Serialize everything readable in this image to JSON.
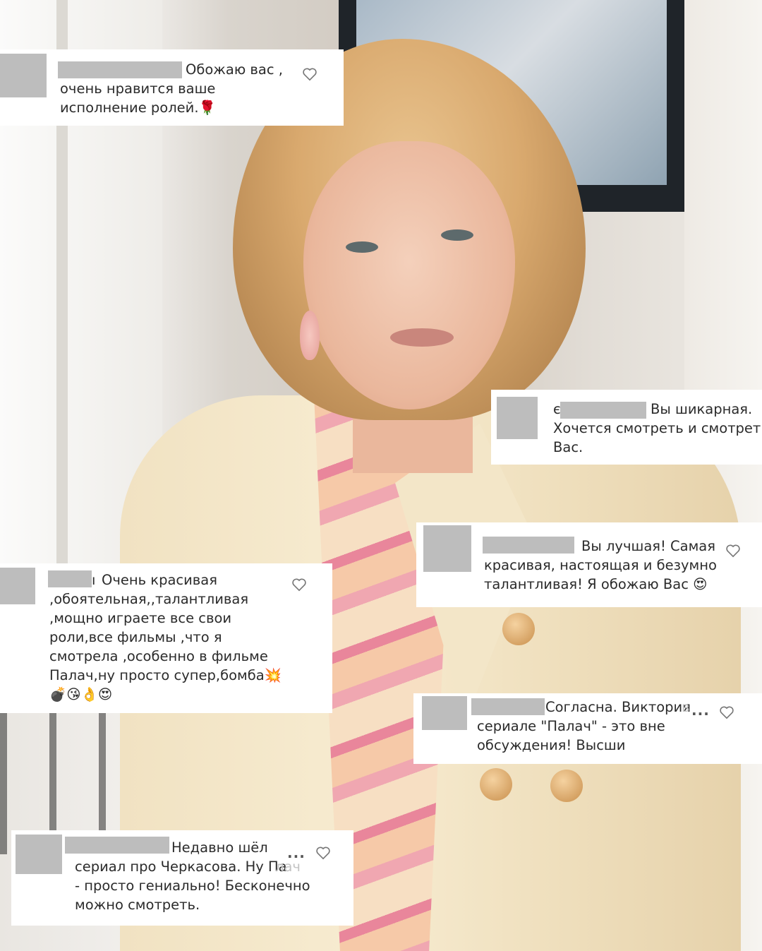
{
  "colors": {
    "card_bg": "#ffffff",
    "redaction": "#bdbdbd",
    "text": "#2b2b2b"
  },
  "icons": {
    "like": "heart-outline-icon",
    "more": "more-dots-icon"
  },
  "comments": [
    {
      "text": "Обожаю вас ,\nочень нравится ваше\nисполнение ролей.🌹"
    },
    {
      "username_prefix": "є",
      "text": "Вы шикарная.\nХочется смотреть и смотреть на\nВас."
    },
    {
      "text": "Вы лучшая! Самая\nкрасивая, настоящая и безумно\nталантливая! Я обожаю Вас 😍"
    },
    {
      "username_suffix": "ı",
      "text": "Очень красивая\n,обоятельная,,талантливая\n,мощно играете все свои\nроли,все фильмы ,что я\nсмотрела ,особенно в фильме\nПалач,ну просто супер,бомба💥\n💣😘👌😍"
    },
    {
      "text": "Согласна. Виктория\nсериале \"Палач\" - это вне\nобсуждения! Высши",
      "faded": "в",
      "more": "..."
    },
    {
      "text": "Недавно шёл\nсериал про Черкасова. Ну Па\n- просто гениально! Бесконечно\nможно смотреть.",
      "faded": "лач",
      "more": "..."
    }
  ]
}
